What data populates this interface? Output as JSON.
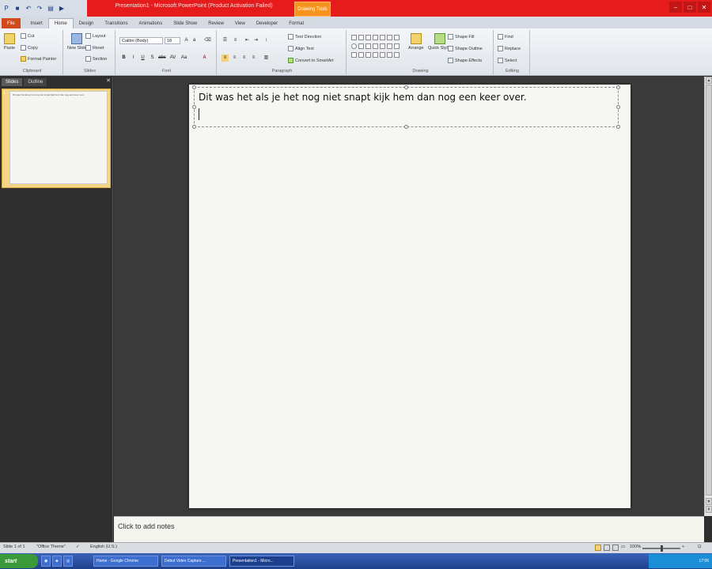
{
  "window": {
    "title": "Presentation1 - Microsoft PowerPoint (Product Activation Failed)",
    "context_tab": "Drawing Tools"
  },
  "tabs": [
    "File",
    "Insert",
    "Home",
    "Design",
    "Transitions",
    "Animations",
    "Slide Show",
    "Review",
    "View",
    "Developer",
    "Format"
  ],
  "active_tab": "Home",
  "ribbon": {
    "clipboard": {
      "label": "Clipboard",
      "paste": "Paste",
      "cut": "Cut",
      "copy": "Copy",
      "format_painter": "Format Painter"
    },
    "slides": {
      "label": "Slides",
      "new_slide": "New Slide",
      "layout": "Layout",
      "reset": "Reset",
      "section": "Section"
    },
    "font": {
      "label": "Font",
      "family": "Calibri (Body)",
      "size": "18"
    },
    "paragraph": {
      "label": "Paragraph",
      "text_direction": "Text Direction",
      "align_text": "Align Text",
      "convert_smartart": "Convert to SmartArt"
    },
    "drawing": {
      "label": "Drawing",
      "arrange": "Arrange",
      "quick_styles": "Quick Styles",
      "shape_fill": "Shape Fill",
      "shape_outline": "Shape Outline",
      "shape_effects": "Shape Effects"
    },
    "editing": {
      "label": "Editing",
      "find": "Find",
      "replace": "Replace",
      "select": "Select"
    }
  },
  "slide_pane": {
    "tabs": [
      "Slides",
      "Outline"
    ],
    "thumbnail_number": "1",
    "thumbnail_text": "Dit was het als je het nog niet snapt kijk hem dan nog een keer over."
  },
  "slide": {
    "text": "Dit was het als je het nog niet snapt kijk hem dan nog een keer over."
  },
  "notes": {
    "placeholder": "Click to add notes"
  },
  "status": {
    "slide_info": "Slide 1 of 1",
    "theme": "\"Office Theme\"",
    "language": "English (U.S.)",
    "zoom": "100%"
  },
  "taskbar": {
    "start": "start",
    "items": [
      "Home - Google Chrome",
      "Debut Video Capture ...",
      "Presentation1 - Micro..."
    ],
    "clock": "17:06"
  }
}
